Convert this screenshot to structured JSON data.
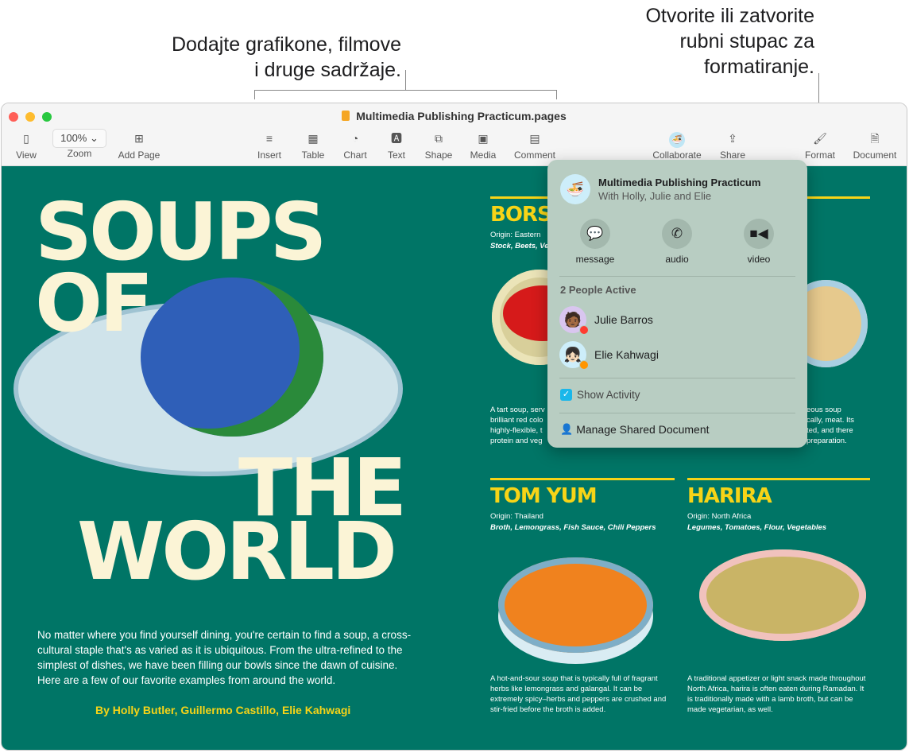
{
  "callouts": {
    "left": [
      "Dodajte grafikone, filmove",
      "i druge sadržaje."
    ],
    "right": [
      "Otvorite ili zatvorite",
      "rubni stupac za",
      "formatiranje."
    ]
  },
  "window": {
    "title": "Multimedia Publishing Practicum.pages"
  },
  "toolbar": {
    "view": "View",
    "zoom_value": "100%",
    "zoom": "Zoom",
    "add_page": "Add Page",
    "insert": "Insert",
    "table": "Table",
    "chart": "Chart",
    "text": "Text",
    "shape": "Shape",
    "media": "Media",
    "comment": "Comment",
    "collaborate": "Collaborate",
    "share": "Share",
    "format": "Format",
    "document": "Document"
  },
  "document": {
    "title_words": [
      "SOUPS",
      "OF",
      "THE",
      "WORLD"
    ],
    "intro": "No matter where you find yourself dining, you're certain to find a soup, a cross-cultural staple that's as varied as it is ubiquitous. From the ultra-refined to the simplest of dishes, we have been filling our bowls since the dawn of cuisine. Here are a few of our favorite examples from around the world.",
    "byline": "By Holly Butler, Guillermo Castillo, Elie Kahwagi",
    "borscht": {
      "title": "BORS",
      "origin": "Origin: Eastern",
      "ingredients": "Stock, Beets, Ve",
      "desc": [
        "A tart soup, serv",
        "brilliant red colo",
        "highly-flexible, t",
        "protein and veg"
      ]
    },
    "right_partial": {
      "desc": [
        "eous soup",
        "cally, meat. Its",
        "ted, and there",
        "preparation."
      ]
    },
    "tomyum": {
      "title": "TOM YUM",
      "origin": "Origin: Thailand",
      "ingredients": "Broth, Lemongrass, Fish Sauce, Chili Peppers",
      "desc": "A hot-and-sour soup that is typically full of fragrant herbs like lemongrass and galangal. It can be extremely spicy–herbs and peppers are crushed and stir-fried before the broth is added."
    },
    "harira": {
      "title": "HARIRA",
      "origin": "Origin: North Africa",
      "ingredients": "Legumes, Tomatoes, Flour, Vegetables",
      "desc": "A traditional appetizer or light snack made throughout North Africa, harira is often eaten during Ramadan. It is traditionally made with a lamb broth, but can be made vegetarian, as well."
    }
  },
  "popover": {
    "title": "Multimedia Publishing Practicum",
    "subtitle": "With Holly, Julie and Elie",
    "actions": [
      "message",
      "audio",
      "video"
    ],
    "active_label": "2 People Active",
    "people": [
      {
        "name": "Julie Barros",
        "status_color": "#ff3b30"
      },
      {
        "name": "Elie Kahwagi",
        "status_color": "#ff9500"
      }
    ],
    "show_activity": "Show Activity",
    "show_activity_checked": true,
    "manage": "Manage Shared Document"
  },
  "colors": {
    "page": "#007566",
    "accent": "#f7d417",
    "title": "#fbf4d6"
  }
}
